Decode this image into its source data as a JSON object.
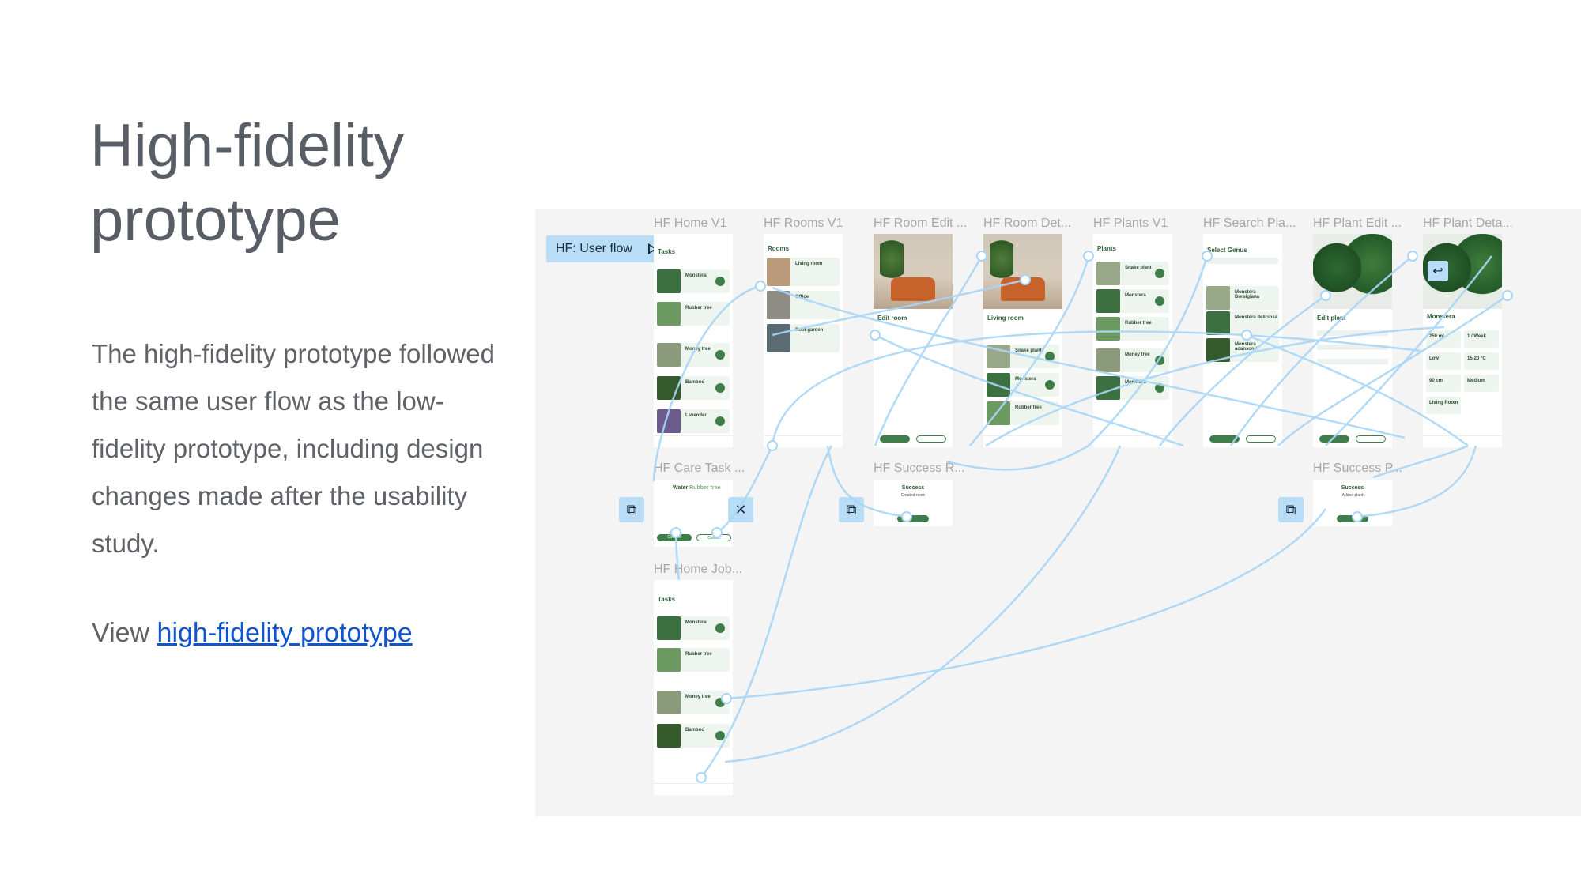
{
  "slide": {
    "title": "High-fidelity\nprototype",
    "body": "The high-fidelity prototype followed the same user flow as the low-fidelity prototype, including design changes made after the usability study.",
    "view_prefix": "View ",
    "view_link": "high-fidelity prototype"
  },
  "canvas": {
    "flow_button": "HF: User flow",
    "frames": [
      {
        "label": "HF Home V1"
      },
      {
        "label": "HF Rooms V1"
      },
      {
        "label": "HF Room Edit ..."
      },
      {
        "label": "HF Room Det..."
      },
      {
        "label": "HF Plants V1"
      },
      {
        "label": "HF Search Pla..."
      },
      {
        "label": "HF Plant Edit ..."
      },
      {
        "label": "HF Plant Deta..."
      },
      {
        "label": "HF Care Task ..."
      },
      {
        "label": "HF Success R..."
      },
      {
        "label": "HF Success P..."
      },
      {
        "label": "HF Home Job..."
      }
    ],
    "screens": {
      "home": {
        "title": "Tasks",
        "rows": [
          "Monstera",
          "Rubber tree",
          "Money tree",
          "Bamboo",
          "Lavender"
        ]
      },
      "rooms": {
        "title": "Rooms",
        "rows": [
          "Living room",
          "Office",
          "Roof garden"
        ]
      },
      "room_edit": {
        "title": "Edit room"
      },
      "room_detail": {
        "title": "Living room",
        "rows": [
          "Snake plant",
          "Monstera",
          "Rubber tree"
        ]
      },
      "plants": {
        "title": "Plants",
        "rows": [
          "Snake plant",
          "Monstera",
          "Rubber tree",
          "Money tree",
          "Monstera"
        ]
      },
      "search": {
        "title": "Select Genus",
        "rows": [
          "Monstera Borsigiana",
          "Monstera deliciosa",
          "Monstera adansonii"
        ]
      },
      "plant_edit": {
        "title": "Edit plant"
      },
      "plant_detail": {
        "title": "Monstera",
        "stats": [
          "250 ml",
          "1 / Week",
          "Low",
          "15-20 °C",
          "90 cm",
          "Medium",
          "Living Room"
        ]
      },
      "care_task": {
        "title": "Water",
        "plant": "Rubber tree",
        "confirm": "Confirm",
        "cancel": "Cancel"
      },
      "success_room": {
        "title": "Success",
        "sub": "Created room"
      },
      "success_plant": {
        "title": "Success",
        "sub": "Added plant"
      },
      "home_job": {
        "title": "Tasks",
        "rows": [
          "Monstera",
          "Rubber tree",
          "Money tree",
          "Bamboo"
        ]
      }
    }
  }
}
